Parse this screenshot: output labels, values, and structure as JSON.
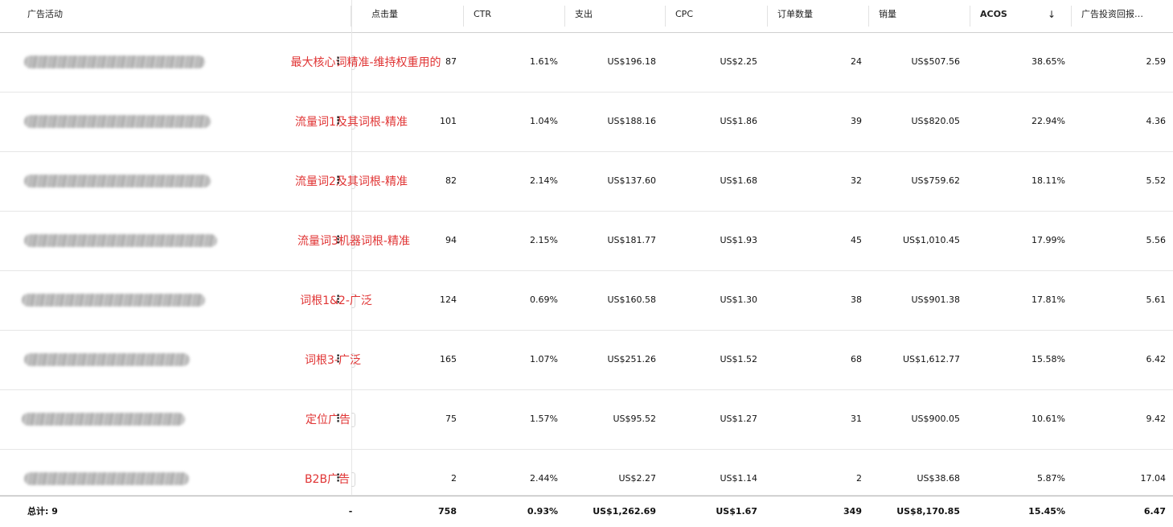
{
  "header": {
    "campaign": "广告活动",
    "clicks": "点击量",
    "ctr": "CTR",
    "spend": "支出",
    "cpc": "CPC",
    "orders": "订单数量",
    "sales": "销量",
    "acos": "ACOS",
    "roas": "广告投资回报…",
    "sort_icon": "↓"
  },
  "rows": [
    {
      "annotation": "最大核心词精准-维持权重用的",
      "clicks": "87",
      "ctr": "1.61%",
      "spend": "US$196.18",
      "cpc": "US$2.25",
      "orders": "24",
      "sales": "US$507.56",
      "acos": "38.65%",
      "roas": "2.59"
    },
    {
      "annotation": "流量词1及其词根-精准",
      "clicks": "101",
      "ctr": "1.04%",
      "spend": "US$188.16",
      "cpc": "US$1.86",
      "orders": "39",
      "sales": "US$820.05",
      "acos": "22.94%",
      "roas": "4.36"
    },
    {
      "annotation": "流量词2及其词根-精准",
      "clicks": "82",
      "ctr": "2.14%",
      "spend": "US$137.60",
      "cpc": "US$1.68",
      "orders": "32",
      "sales": "US$759.62",
      "acos": "18.11%",
      "roas": "5.52"
    },
    {
      "annotation": "流量词3机器词根-精准",
      "clicks": "94",
      "ctr": "2.15%",
      "spend": "US$181.77",
      "cpc": "US$1.93",
      "orders": "45",
      "sales": "US$1,010.45",
      "acos": "17.99%",
      "roas": "5.56"
    },
    {
      "annotation": "词根1&2-广泛",
      "clicks": "124",
      "ctr": "0.69%",
      "spend": "US$160.58",
      "cpc": "US$1.30",
      "orders": "38",
      "sales": "US$901.38",
      "acos": "17.81%",
      "roas": "5.61"
    },
    {
      "annotation": "词根3-广泛",
      "clicks": "165",
      "ctr": "1.07%",
      "spend": "US$251.26",
      "cpc": "US$1.52",
      "orders": "68",
      "sales": "US$1,612.77",
      "acos": "15.58%",
      "roas": "6.42"
    },
    {
      "annotation": "定位广告",
      "clicks": "75",
      "ctr": "1.57%",
      "spend": "US$95.52",
      "cpc": "US$1.27",
      "orders": "31",
      "sales": "US$900.05",
      "acos": "10.61%",
      "roas": "9.42"
    },
    {
      "annotation": "B2B广告",
      "clicks": "2",
      "ctr": "2.44%",
      "spend": "US$2.27",
      "cpc": "US$1.14",
      "orders": "2",
      "sales": "US$38.68",
      "acos": "5.87%",
      "roas": "17.04"
    }
  ],
  "footer": {
    "total_label": "总计: 9",
    "dash": "-",
    "clicks": "758",
    "ctr": "0.93%",
    "spend": "US$1,262.69",
    "cpc": "US$1.67",
    "orders": "349",
    "sales": "US$8,170.85",
    "acos": "15.45%",
    "roas": "6.47"
  },
  "colors": {
    "annotation": "#e03434",
    "header_border": "#cfcfcf",
    "row_border": "#e6e6e6"
  },
  "icons": {
    "sort": "arrow-down-icon",
    "row_menu": "kebab-menu-icon"
  }
}
